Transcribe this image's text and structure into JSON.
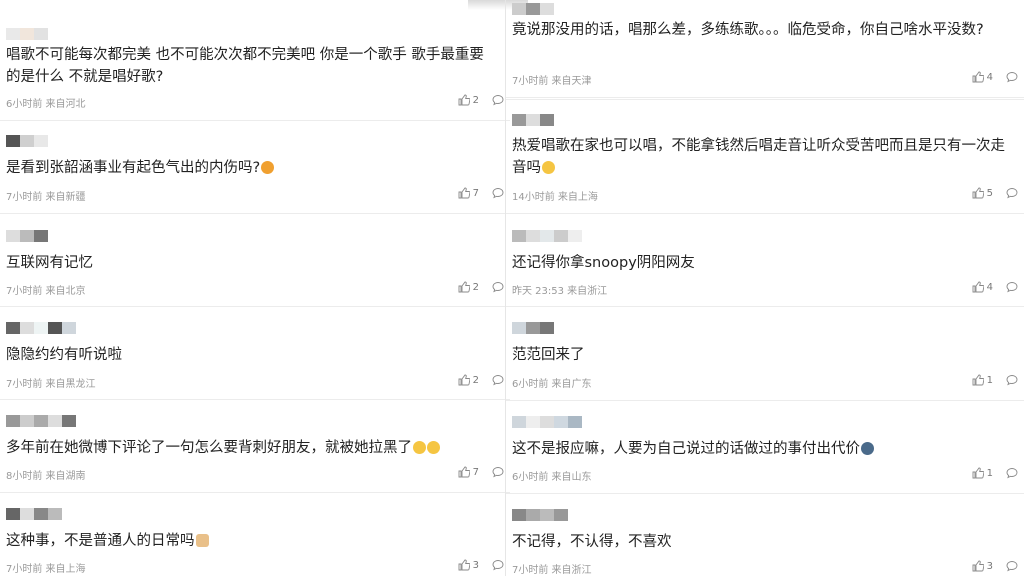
{
  "left": [
    {
      "text": "唱歌不可能每次都完美 也不可能次次都不完美吧 你是一个歌手 歌手最重要的是什么 不就是唱好歌?",
      "meta": "6小时前 来自河北",
      "likes": "2"
    },
    {
      "text": "是看到张韶涵事业有起色气出的内伤吗?",
      "meta": "7小时前 来自新疆",
      "likes": "7"
    },
    {
      "text": "互联网有记忆",
      "meta": "7小时前 来自北京",
      "likes": "2"
    },
    {
      "text": "隐隐约约有听说啦",
      "meta": "7小时前 来自黑龙江",
      "likes": "2"
    },
    {
      "text": "多年前在她微博下评论了一句怎么要背刺好朋友，就被她拉黑了",
      "meta": "8小时前 来自湖南",
      "likes": "7"
    },
    {
      "text": "这种事，不是普通人的日常吗",
      "meta": "7小时前 来自上海",
      "likes": "3"
    }
  ],
  "right": [
    {
      "text": "竟说那没用的话，唱那么差，多练练歌。。。临危受命，你自己啥水平没数?",
      "meta": "7小时前 来自天津",
      "likes": "4"
    },
    {
      "text": "热爱唱歌在家也可以唱，不能拿钱然后唱走音让听众受苦吧而且是只有一次走音吗",
      "meta": "14小时前 来自上海",
      "likes": "5"
    },
    {
      "text": "还记得你拿snoopy阴阳网友",
      "meta": "昨天 23:53 来自浙江",
      "likes": "4"
    },
    {
      "text": "范范回来了",
      "meta": "6小时前 来自广东",
      "likes": "1"
    },
    {
      "text": "这不是报应嘛，人要为自己说过的话做过的事付出代价",
      "meta": "6小时前 来自山东",
      "likes": "1"
    },
    {
      "text": "不记得，不认得，不喜欢",
      "meta": "7小时前 来自浙江",
      "likes": "3"
    }
  ],
  "colors": {
    "meta": "#9a9a9a",
    "text": "#222222",
    "emoji": "#f5c542"
  },
  "icons": {
    "like": "thumbs-up-icon",
    "reply": "comment-bubble-icon"
  }
}
